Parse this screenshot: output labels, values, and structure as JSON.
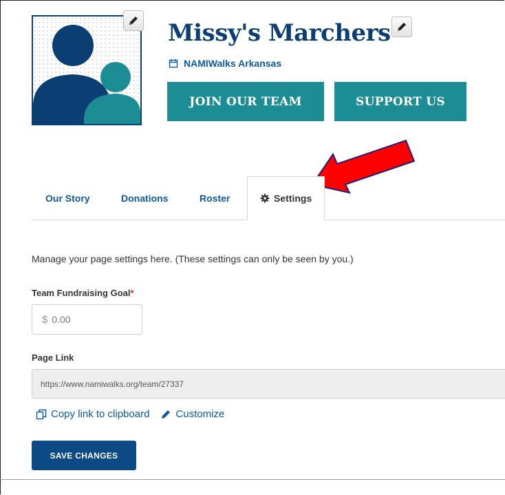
{
  "team": {
    "name": "Missy's Marchers",
    "event_name": "NAMIWalks Arkansas",
    "join_label": "JOIN OUR TEAM",
    "support_label": "SUPPORT US"
  },
  "tabs": [
    {
      "label": "Our Story"
    },
    {
      "label": "Donations"
    },
    {
      "label": "Roster"
    },
    {
      "label": "Settings",
      "icon": "gear-icon",
      "active": true
    }
  ],
  "settings": {
    "intro": "Manage your page settings here. (These settings can only be seen by you.)",
    "goal_label": "Team Fundraising Goal",
    "goal_required_mark": "*",
    "goal_currency": "$",
    "goal_value": "0.00",
    "page_link_label": "Page Link",
    "page_link_value": "https://www.namiwalks.org/team/27337",
    "copy_link_label": "Copy link to clipboard",
    "customize_label": "Customize",
    "save_label": "SAVE CHANGES"
  },
  "colors": {
    "brand_navy": "#0b3f73",
    "teal": "#1c8c95",
    "link_blue": "#0b5aa3",
    "save_button": "#0b4a85",
    "annotation_red": "#ff0000"
  },
  "icons": {
    "edit": "pencil-icon",
    "calendar": "calendar-icon",
    "settings_tab": "gear-icon",
    "copy": "copy-icon",
    "customize": "pencil-icon",
    "avatar": "team-avatar-icon",
    "annotation": "red-arrow-annotation"
  }
}
